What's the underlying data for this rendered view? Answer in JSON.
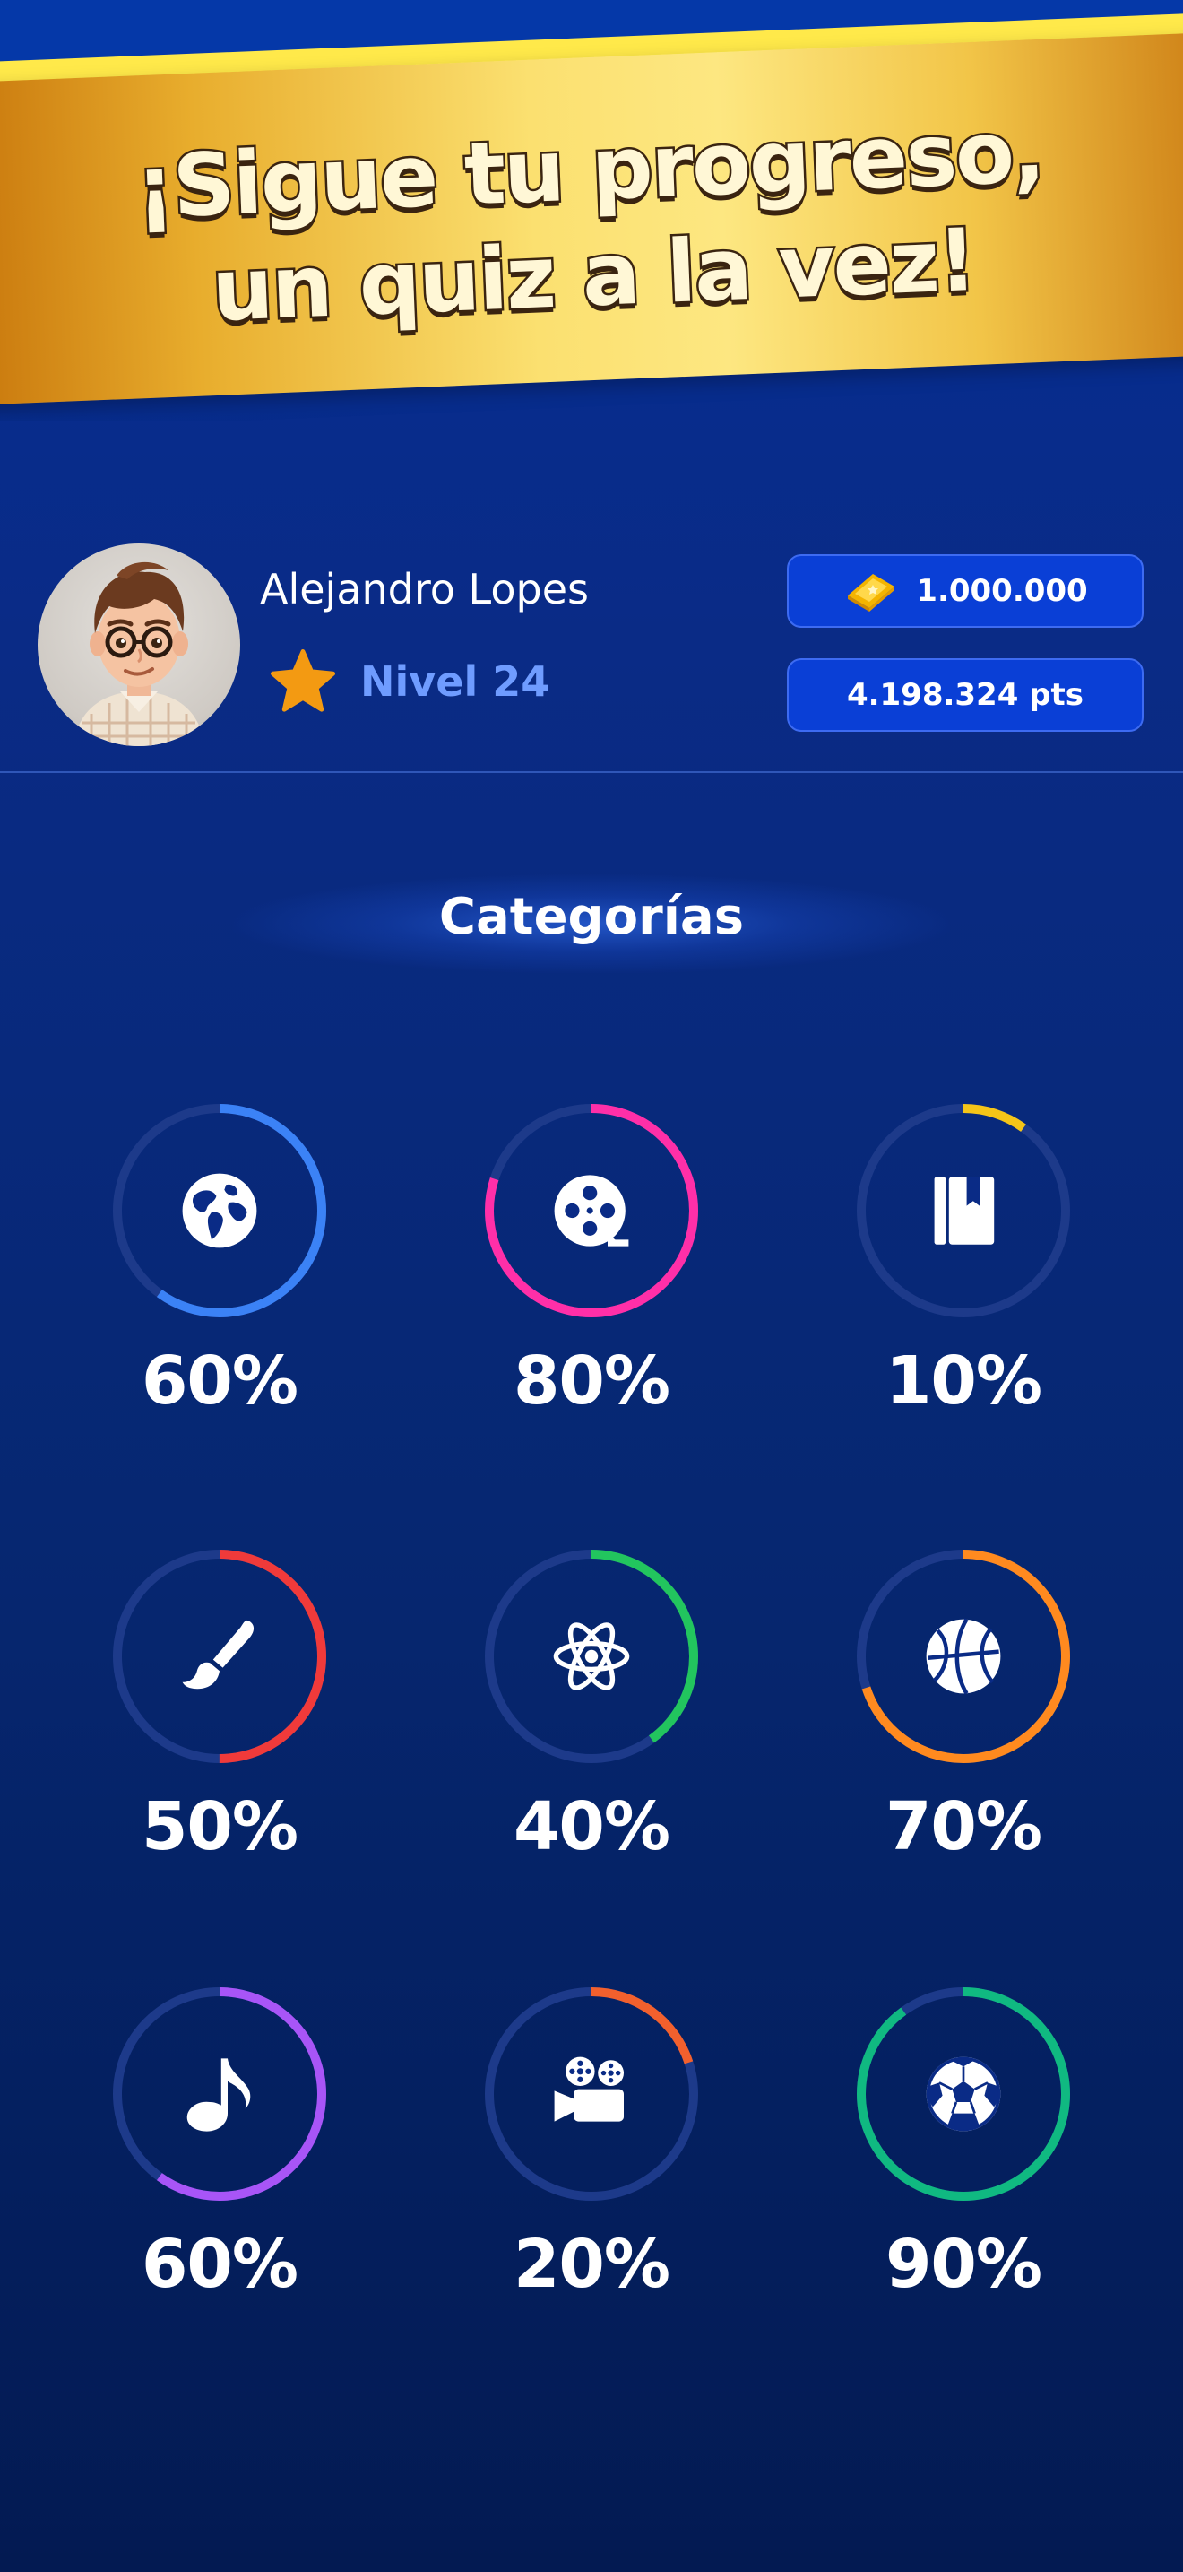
{
  "banner": {
    "line1": "¡Sigue tu progreso,",
    "line2": "un quiz a la vez!"
  },
  "profile": {
    "name": "Alejandro Lopes",
    "level": "Nivel 24",
    "coins": "1.000.000",
    "points": "4.198.324 pts"
  },
  "section": {
    "title": "Categorías"
  },
  "categories": [
    {
      "icon": "globe-icon",
      "percent_label": "60%",
      "progress": 0.6,
      "color": "#3b82f6"
    },
    {
      "icon": "film-reel-icon",
      "percent_label": "80%",
      "progress": 0.8,
      "color": "#ff2fa8"
    },
    {
      "icon": "book-icon",
      "percent_label": "10%",
      "progress": 0.1,
      "color": "#f5c518"
    },
    {
      "icon": "paintbrush-icon",
      "percent_label": "50%",
      "progress": 0.5,
      "color": "#f03a3a"
    },
    {
      "icon": "atom-icon",
      "percent_label": "40%",
      "progress": 0.4,
      "color": "#22c55e"
    },
    {
      "icon": "basketball-icon",
      "percent_label": "70%",
      "progress": 0.7,
      "color": "#ff8a1f"
    },
    {
      "icon": "music-note-icon",
      "percent_label": "60%",
      "progress": 0.6,
      "color": "#a855f7"
    },
    {
      "icon": "movie-camera-icon",
      "percent_label": "20%",
      "progress": 0.2,
      "color": "#f2602d"
    },
    {
      "icon": "soccer-ball-icon",
      "percent_label": "90%",
      "progress": 0.9,
      "color": "#10b981"
    }
  ],
  "colors": {
    "ring_track": "#1d3a8a"
  }
}
